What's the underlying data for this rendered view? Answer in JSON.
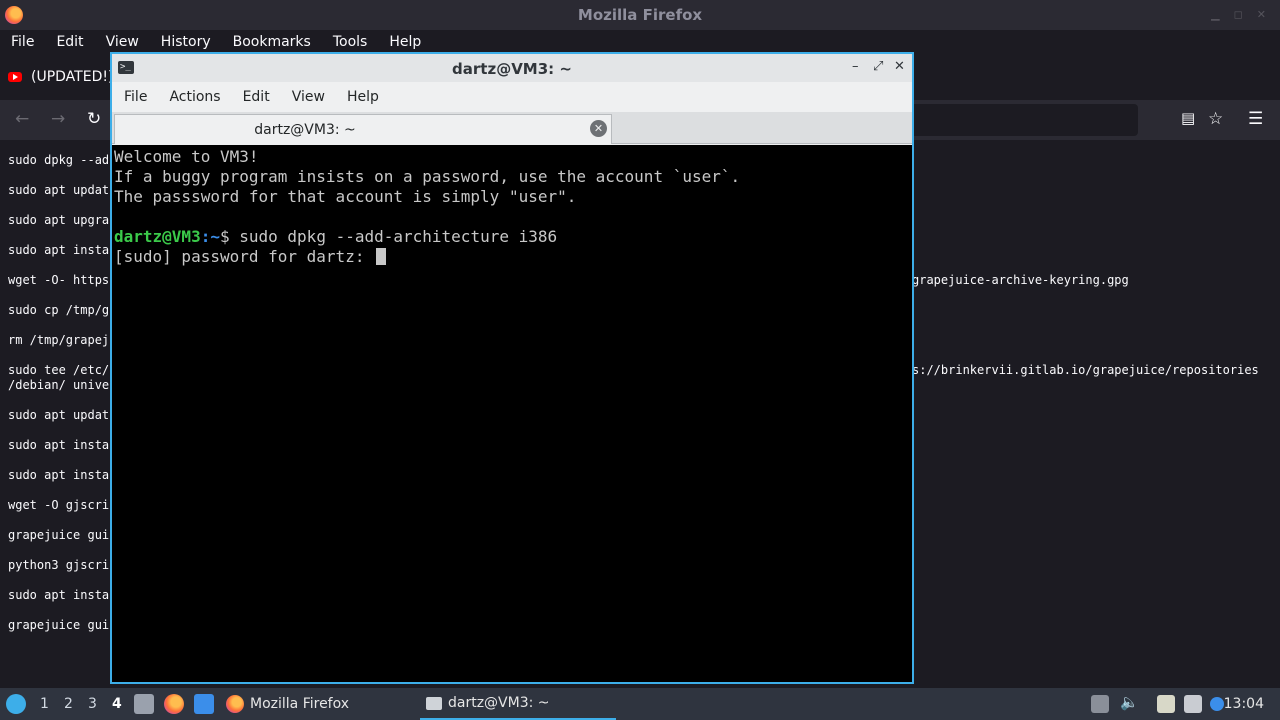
{
  "firefox": {
    "window_title": "Mozilla Firefox",
    "menu": [
      {
        "label": "File"
      },
      {
        "label": "Edit"
      },
      {
        "label": "View"
      },
      {
        "label": "History"
      },
      {
        "label": "Bookmarks"
      },
      {
        "label": "Tools"
      },
      {
        "label": "Help"
      }
    ],
    "tab_label": "(UPDATED!)",
    "page_lines_left": [
      "sudo dpkg --ad",
      "sudo apt updat",
      "sudo apt upgra",
      "sudo apt insta",
      "wget -O- https",
      "sudo cp /tmp/g",
      "rm /tmp/grapej",
      "sudo tee /etc/",
      "/debian/ unive",
      "sudo apt updat",
      "sudo apt insta",
      "sudo apt insta",
      "wget -O gjscri",
      "grapejuice gui",
      "python3 gjscri",
      "sudo apt insta",
      "grapejuice gui"
    ],
    "page_lines_right": [
      "grapejuice-archive-keyring.gpg",
      "s://brinkervii.gitlab.io/grapejuice/repositories"
    ]
  },
  "terminal": {
    "window_title": "dartz@VM3: ~",
    "menu": [
      {
        "label": "File"
      },
      {
        "label": "Actions"
      },
      {
        "label": "Edit"
      },
      {
        "label": "View"
      },
      {
        "label": "Help"
      }
    ],
    "tab_label": "dartz@VM3: ~",
    "lines": {
      "l1": "Welcome to VM3!",
      "l2": "If a buggy program insists on a password, use the account `user`.",
      "l3": "The passsword for that account is simply \"user\".",
      "prompt_user": "dartz@VM3",
      "prompt_sep": ":",
      "prompt_path": "~",
      "prompt_cmd": "$ sudo dpkg --add-architecture i386",
      "sudo_prompt": "[sudo] password for dartz: "
    }
  },
  "taskbar": {
    "workspaces": [
      "1",
      "2",
      "3",
      "4"
    ],
    "active_workspace": "4",
    "tasks": [
      {
        "label": "Mozilla Firefox"
      },
      {
        "label": "dartz@VM3: ~"
      }
    ],
    "clock": "13:04"
  },
  "colors": {
    "accent": "#3daee9",
    "prompt_user": "#3bc94a",
    "prompt_path": "#3b8eea"
  }
}
